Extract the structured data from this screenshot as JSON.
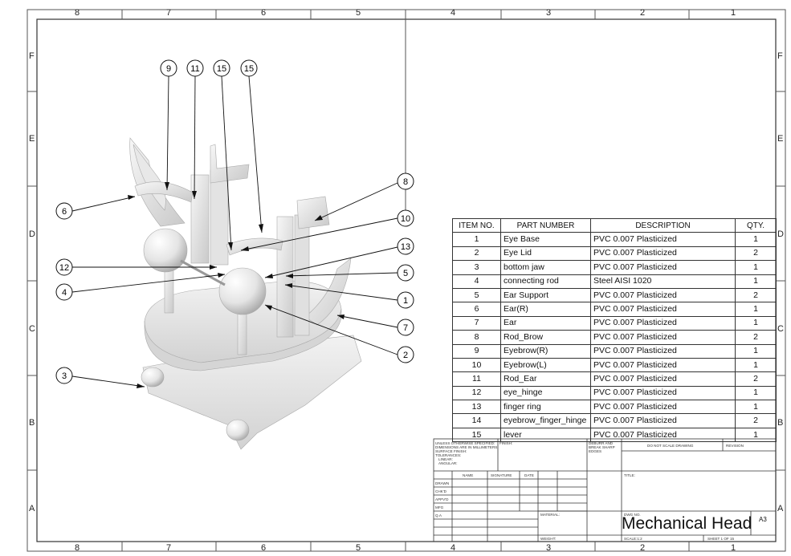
{
  "zones": {
    "columns": [
      "8",
      "7",
      "6",
      "5",
      "4",
      "3",
      "2",
      "1"
    ],
    "rows": [
      "F",
      "E",
      "D",
      "C",
      "B",
      "A"
    ]
  },
  "balloons": [
    "9",
    "11",
    "15",
    "15",
    "6",
    "8",
    "10",
    "13",
    "12",
    "5",
    "4",
    "1",
    "7",
    "2",
    "3"
  ],
  "bom": {
    "headers": [
      "ITEM NO.",
      "PART NUMBER",
      "DESCRIPTION",
      "QTY."
    ],
    "rows": [
      [
        "1",
        "Eye Base",
        "PVC 0.007 Plasticized",
        "1"
      ],
      [
        "2",
        "Eye Lid",
        "PVC 0.007 Plasticized",
        "2"
      ],
      [
        "3",
        "bottom jaw",
        "PVC 0.007 Plasticized",
        "1"
      ],
      [
        "4",
        "connecting rod",
        "Steel AISI 1020",
        "1"
      ],
      [
        "5",
        "Ear Support",
        "PVC 0.007 Plasticized",
        "2"
      ],
      [
        "6",
        "Ear(R)",
        "PVC 0.007 Plasticized",
        "1"
      ],
      [
        "7",
        "Ear",
        "PVC 0.007 Plasticized",
        "1"
      ],
      [
        "8",
        "Rod_Brow",
        "PVC 0.007 Plasticized",
        "2"
      ],
      [
        "9",
        "Eyebrow(R)",
        "PVC 0.007 Plasticized",
        "1"
      ],
      [
        "10",
        "Eyebrow(L)",
        "PVC 0.007 Plasticized",
        "1"
      ],
      [
        "11",
        "Rod_Ear",
        "PVC 0.007 Plasticized",
        "2"
      ],
      [
        "12",
        "eye_hinge",
        "PVC 0.007 Plasticized",
        "1"
      ],
      [
        "13",
        "finger ring",
        "PVC 0.007 Plasticized",
        "1"
      ],
      [
        "14",
        "eyebrow_finger_hinge",
        "PVC 0.007 Plasticized",
        "2"
      ],
      [
        "15",
        "lever",
        "PVC 0.007 Plasticized",
        "1"
      ]
    ]
  },
  "title_block": {
    "tolerance_note": [
      "UNLESS OTHERWISE SPECIFIED:",
      "DIMENSIONS ARE IN MILLIMETERS",
      "SURFACE FINISH:",
      "TOLERANCES:",
      "LINEAR:",
      "ANGULAR:"
    ],
    "finish": "FINISH:",
    "deburr": [
      "DEBURR AND",
      "BREAK SHARP",
      "EDGES"
    ],
    "do_not_scale": "DO NOT SCALE DRAWING",
    "revision": "REVISION",
    "name_col": "NAME",
    "signature_col": "SIGNATURE",
    "date_col": "DATE",
    "roles": [
      "DRAWN",
      "CHK'D",
      "APPV'D",
      "MFG",
      "Q.A"
    ],
    "title_label": "TITLE:",
    "material": "MATERIAL:",
    "dwg_no": "DWG NO.",
    "drawing_title": "Mechanical Head",
    "size": "A3",
    "weight": "WEIGHT:",
    "scale": "SCALE:1:2",
    "sheet": "SHEET 1 OF 15"
  }
}
